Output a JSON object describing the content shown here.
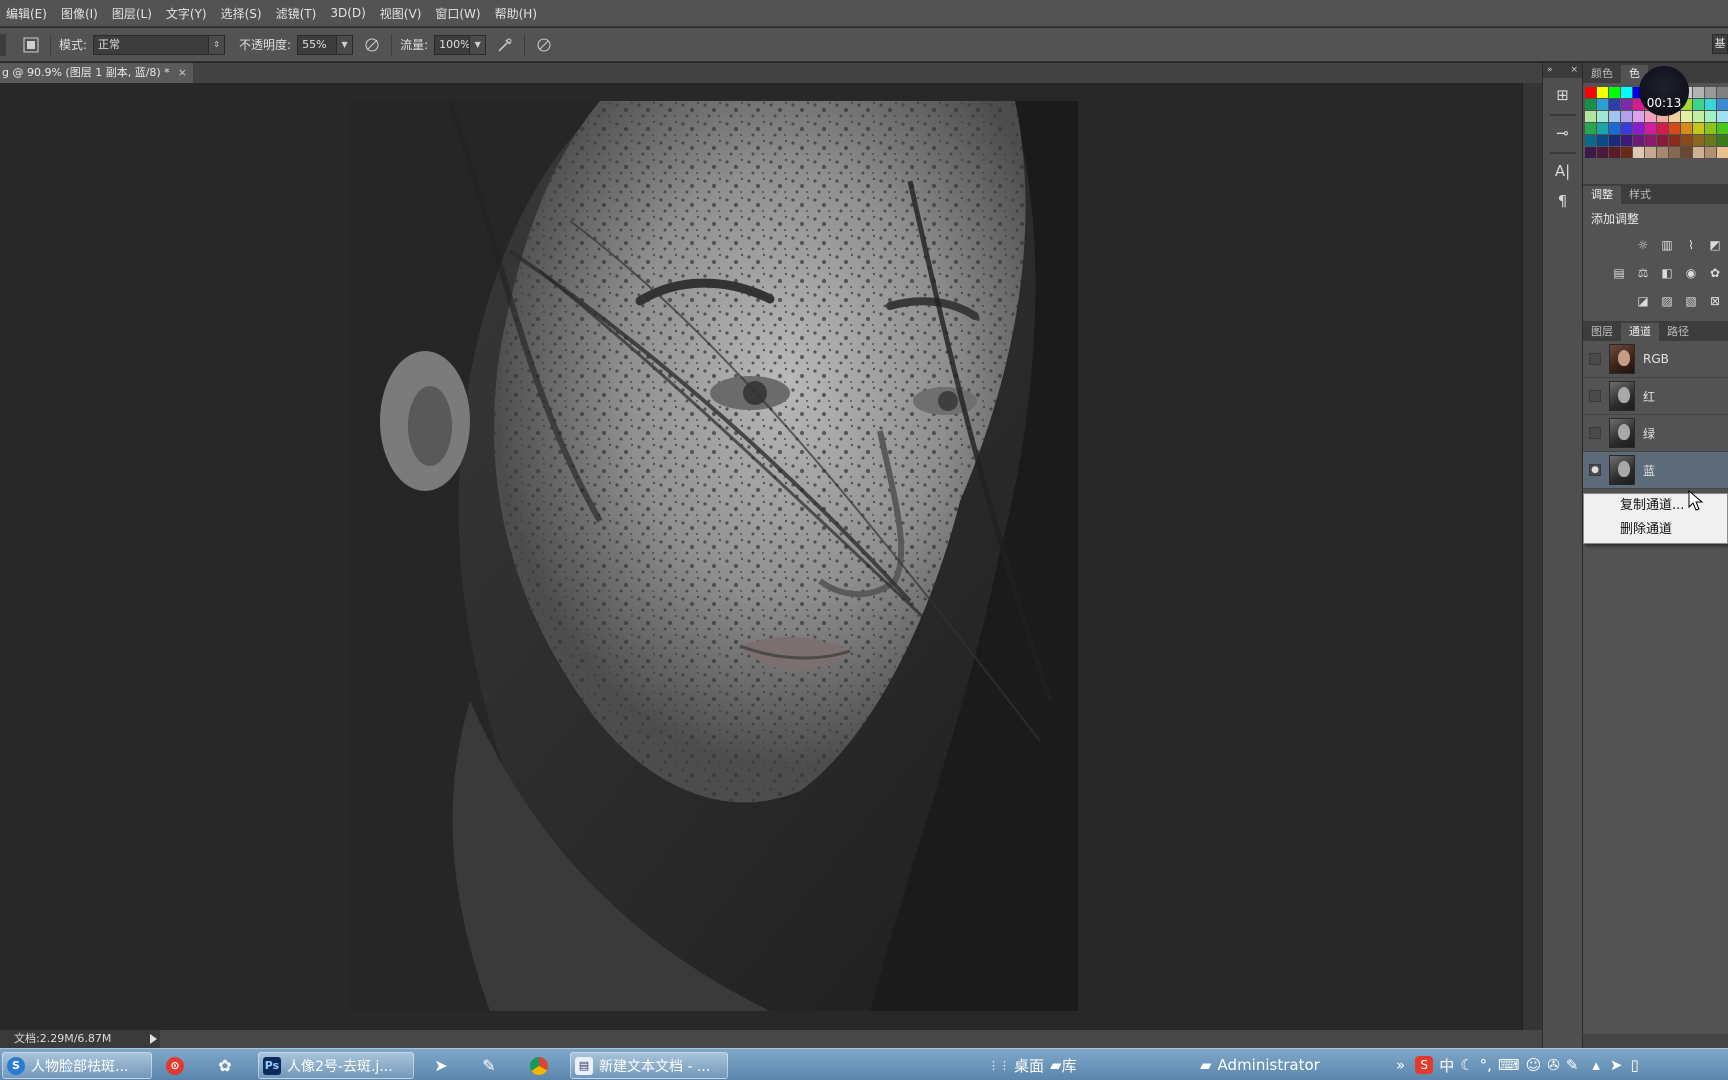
{
  "menu": [
    "编辑(E)",
    "图像(I)",
    "图层(L)",
    "文字(Y)",
    "选择(S)",
    "滤镜(T)",
    "3D(D)",
    "视图(V)",
    "窗口(W)",
    "帮助(H)"
  ],
  "options": {
    "mode_label": "模式:",
    "mode_value": "正常",
    "opacity_label": "不透明度:",
    "opacity_value": "55%",
    "flow_label": "流量:",
    "flow_value": "100%",
    "right_button": "基"
  },
  "document": {
    "tab_title": "g @ 90.9% (图层 1 副本, 蓝/8) *",
    "close": "×",
    "status": "文档:2.29M/6.87M"
  },
  "panel_tools": {
    "collapse": "»",
    "close": "×"
  },
  "swatch_panel": {
    "tabs": [
      "颜色",
      "色"
    ]
  },
  "timer": "00:13",
  "adjust_panel": {
    "tabs": [
      "调整",
      "样式"
    ],
    "title": "添加调整"
  },
  "layers_panel": {
    "tabs": [
      "图层",
      "通道",
      "路径"
    ],
    "channels": [
      {
        "name": "RGB"
      },
      {
        "name": "红"
      },
      {
        "name": "绿"
      },
      {
        "name": "蓝"
      }
    ]
  },
  "context_menu": [
    "复制通道...",
    "删除通道"
  ],
  "taskbar": {
    "items": [
      "人物脸部祛斑...",
      "人像2号-去斑.j...",
      "新建文本文档 - ..."
    ],
    "desktop": "桌面",
    "library": "库",
    "user": "Administrator",
    "ime": "中"
  },
  "colors": {
    "chrome": "#535353",
    "canvas_bg": "#282828",
    "selected_channel": "#5d6a7a",
    "taskbar": "#6b94b8"
  }
}
